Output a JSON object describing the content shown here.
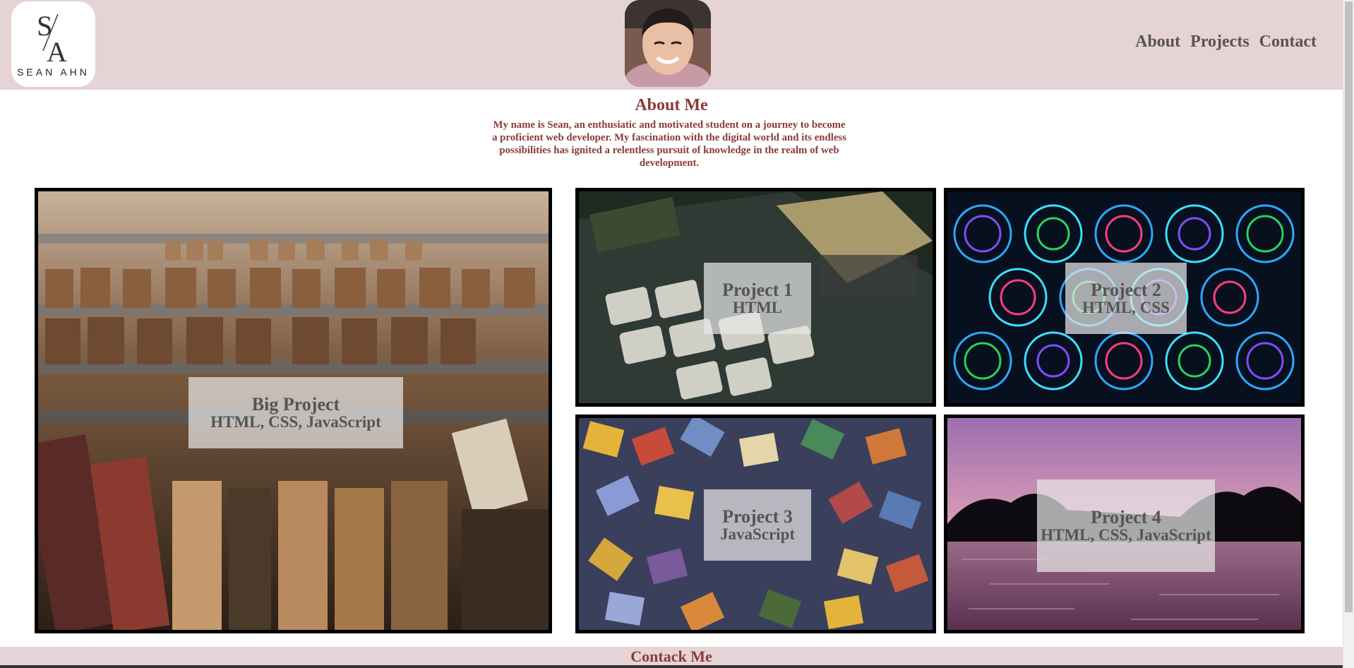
{
  "header": {
    "logo": {
      "monogram": "S/A",
      "caption": "SEAN   AHN"
    },
    "nav": [
      "About",
      "Projects",
      "Contact"
    ]
  },
  "about": {
    "title": "About Me",
    "text": "My name is Sean, an enthusiatic and motivated student on a journey to become a proficient web developer. My fascination with the digital world and its endless possibilities has ignited a relentless pursuit of knowledge in the realm of web development."
  },
  "projects": [
    {
      "title": "Big Project",
      "subtitle": "HTML, CSS, JavaScript",
      "image": "bookshelf-image"
    },
    {
      "title": "Project 1",
      "subtitle": "HTML",
      "image": "calculator-image"
    },
    {
      "title": "Project 2",
      "subtitle": "HTML, CSS",
      "image": "neon-swirls-image"
    },
    {
      "title": "Project 3",
      "subtitle": "JavaScript",
      "image": "puzzle-pieces-image"
    },
    {
      "title": "Project 4",
      "subtitle": "HTML, CSS, JavaScript",
      "image": "lake-sunset-image"
    }
  ],
  "footer": {
    "title": "Contack Me"
  },
  "colors": {
    "header_bg": "#e6d3d5",
    "accent": "#8b3a3a",
    "label_text": "#555555"
  }
}
